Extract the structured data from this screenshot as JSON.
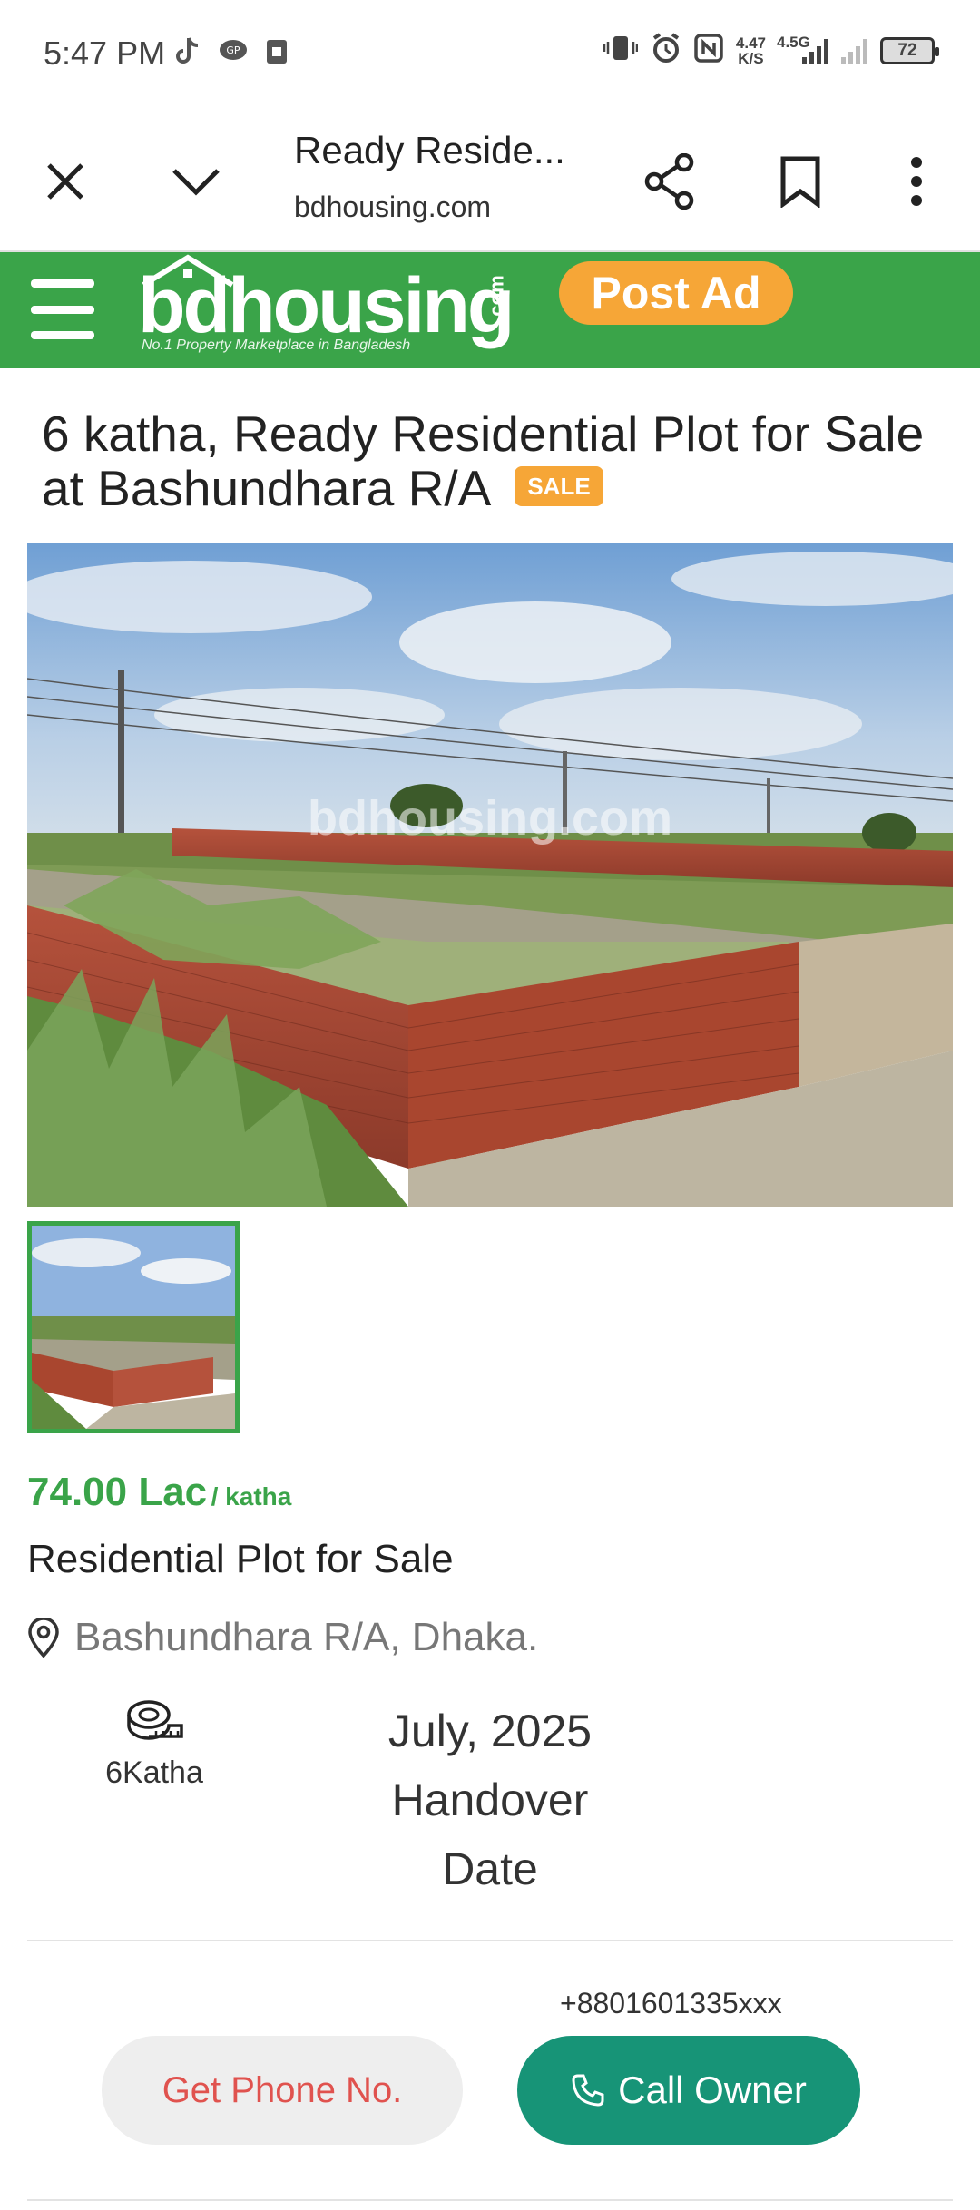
{
  "status_bar": {
    "time": "5:47 PM",
    "net_speed_value": "4.47",
    "net_speed_unit": "K/S",
    "network_type": "4.5G",
    "battery": "72"
  },
  "browser": {
    "title": "Ready Reside...",
    "domain": "bdhousing.com"
  },
  "site_header": {
    "logo_bd": "bd",
    "logo_housing": "housing",
    "logo_com": ".com",
    "logo_tagline": "No.1 Property Marketplace in Bangladesh",
    "post_ad_label": "Post Ad"
  },
  "listing": {
    "title": "6 katha, Ready Residential Plot for Sale at Bashundhara R/A",
    "badge": "SALE",
    "watermark": "bdhousing.com",
    "price_amount": "74.00 Lac",
    "price_unit": "/ katha",
    "property_type": "Residential Plot for Sale",
    "location": "Bashundhara R/A, Dhaka.",
    "size": "6Katha",
    "handover": "July, 2025 Handover Date"
  },
  "contact": {
    "phone_masked": "+8801601335xxx",
    "get_phone_label": "Get Phone No.",
    "call_owner_label": "Call Owner"
  },
  "colors": {
    "brand_green": "#3aa449",
    "accent_orange": "#f6a637",
    "call_green": "#179477",
    "get_phone_red": "#e0524e"
  }
}
